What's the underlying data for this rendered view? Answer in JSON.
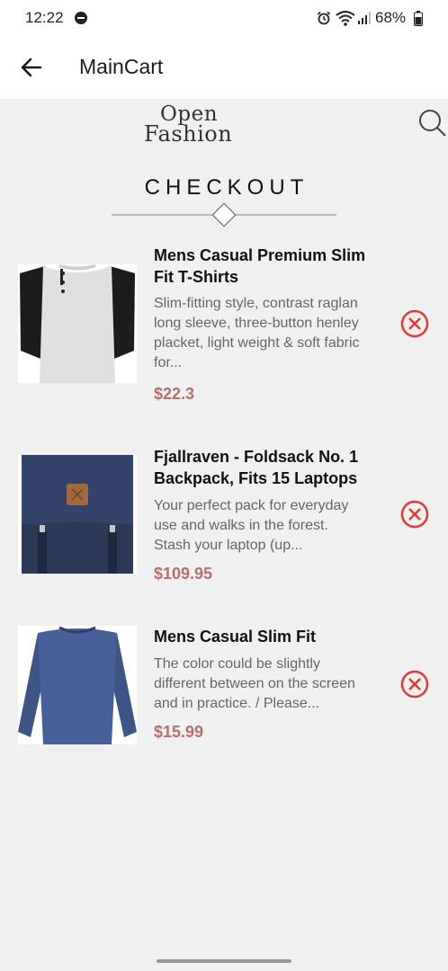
{
  "status_bar": {
    "time": "12:22",
    "battery": "68%",
    "icons": [
      "do-not-disturb-icon",
      "alarm-icon",
      "wifi-icon",
      "signal-icon",
      "battery-icon"
    ]
  },
  "app_bar": {
    "title": "MainCart",
    "back_icon": "arrow-left-icon"
  },
  "brand": {
    "logo_line1": "Open",
    "logo_line2": "Fashion",
    "search_icon": "search-icon"
  },
  "checkout": {
    "title": "CHECKOUT"
  },
  "colors": {
    "background": "#f0f0f0",
    "price": "#b5706e",
    "remove": "#e53935",
    "title_text": "#111111",
    "desc_text": "#666666"
  },
  "cart_items": [
    {
      "title_line1": "Mens Casual Premium Slim",
      "title_line2": "Fit T-Shirts",
      "desc_line1": "Slim-fitting style, contrast raglan",
      "desc_line2": "long sleeve, three-button henley",
      "desc_line3": "placket, light weight & soft fabric",
      "desc_line4": "for...",
      "price": "$22.3",
      "image_icon": "henley-shirt-image"
    },
    {
      "title_line1": "Fjallraven - Foldsack No. 1",
      "title_line2": "Backpack, Fits 15 Laptops",
      "desc_line1": "Your perfect pack for everyday",
      "desc_line2": "use and walks in the forest.",
      "desc_line3": "Stash your laptop (up...",
      "price": "$109.95",
      "image_icon": "backpack-image"
    },
    {
      "title_line1": "Mens Casual Slim Fit",
      "desc_line1": "The color could be slightly",
      "desc_line2": "different between on the screen",
      "desc_line3": "and in practice. / Please...",
      "price": "$15.99",
      "image_icon": "long-sleeve-shirt-image"
    }
  ]
}
